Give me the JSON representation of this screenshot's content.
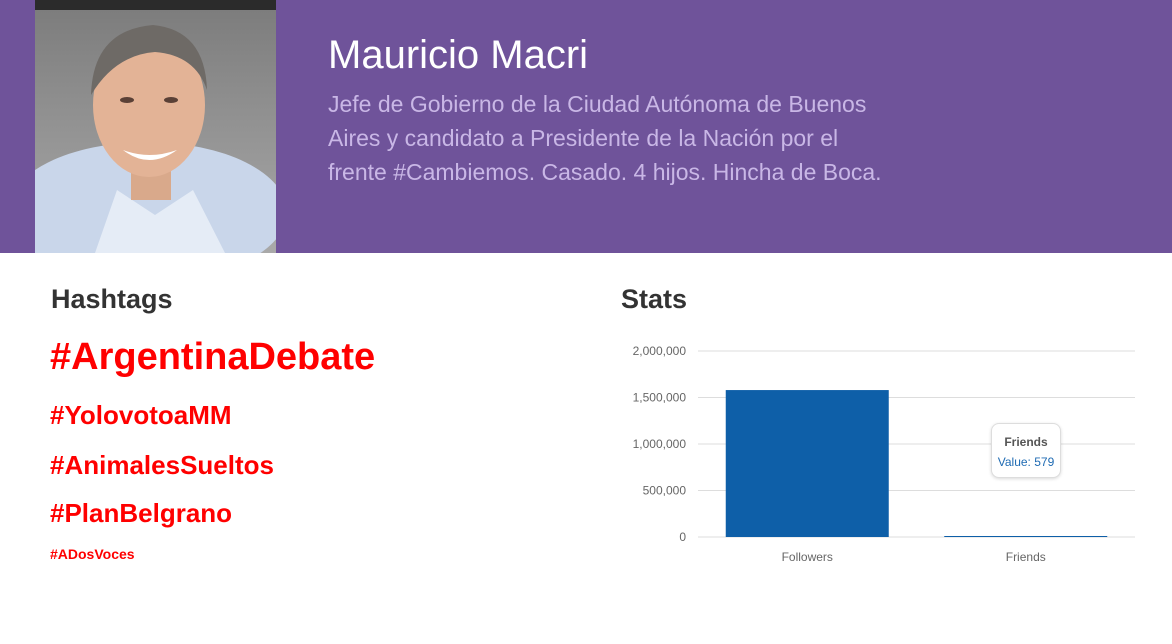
{
  "profile": {
    "name": "Mauricio Macri",
    "bio": "Jefe de Gobierno de la Ciudad Autónoma de Buenos Aires y candidato a Presidente de la Nación por el frente #Cambiemos. Casado. 4 hijos. Hincha de Boca."
  },
  "hashtags": {
    "title": "Hashtags",
    "items": [
      "#ArgentinaDebate",
      "#YolovotoaMM",
      "#AnimalesSueltos",
      "#PlanBelgrano",
      "#ADosVoces"
    ]
  },
  "stats": {
    "title": "Stats",
    "tooltip": {
      "title": "Friends",
      "value_text": "Value: 579"
    }
  },
  "colors": {
    "header": "#6f539a",
    "hashtag": "#ff0000",
    "bar": "#0e5fa8"
  },
  "chart_data": {
    "type": "bar",
    "categories": [
      "Followers",
      "Friends"
    ],
    "values": [
      1580000,
      579
    ],
    "ylim": [
      0,
      2000000
    ],
    "yticks": [
      0,
      500000,
      1000000,
      1500000,
      2000000
    ],
    "ytick_labels": [
      "0",
      "500,000",
      "1,000,000",
      "1,500,000",
      "2,000,000"
    ],
    "grid": true,
    "title": "",
    "xlabel": "",
    "ylabel": ""
  }
}
